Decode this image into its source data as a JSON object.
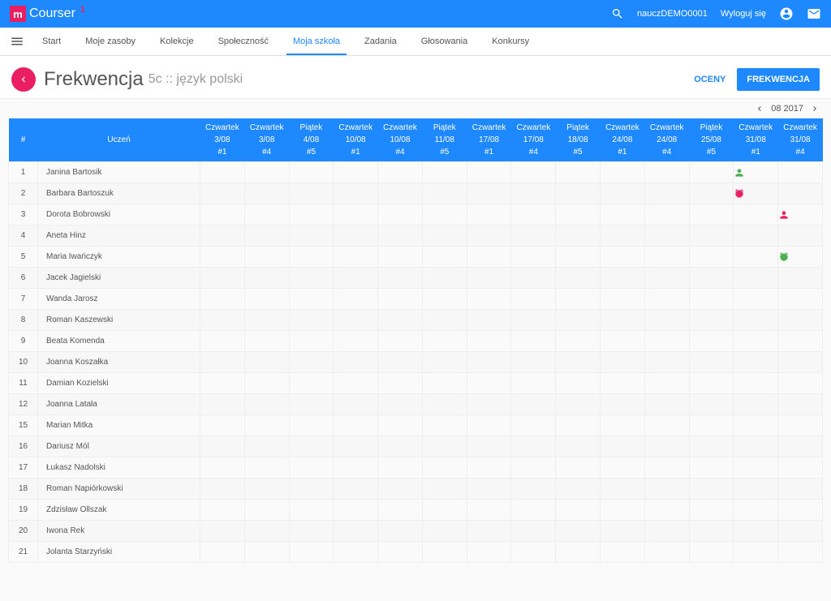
{
  "appbar": {
    "logo_text": "Courser",
    "badge": "1",
    "user": "nauczDEMO0001",
    "logout": "Wyloguj się"
  },
  "nav": {
    "items": [
      "Start",
      "Moje zasoby",
      "Kolekcje",
      "Społeczność",
      "Moja szkoła",
      "Zadania",
      "Głosowania",
      "Konkursy"
    ],
    "active_index": 4
  },
  "title": {
    "main": "Frekwencja",
    "sub": "5c :: język polski",
    "oceny": "OCENY",
    "frekwencja_btn": "FREKWENCJA"
  },
  "month": {
    "label": "08 2017"
  },
  "columns": {
    "idx": "#",
    "name": "Uczeń",
    "days": [
      {
        "dow": "Czwartek",
        "date": "3/08",
        "slot": "#1"
      },
      {
        "dow": "Czwartek",
        "date": "3/08",
        "slot": "#4"
      },
      {
        "dow": "Piątek",
        "date": "4/08",
        "slot": "#5"
      },
      {
        "dow": "Czwartek",
        "date": "10/08",
        "slot": "#1"
      },
      {
        "dow": "Czwartek",
        "date": "10/08",
        "slot": "#4"
      },
      {
        "dow": "Piątek",
        "date": "11/08",
        "slot": "#5"
      },
      {
        "dow": "Czwartek",
        "date": "17/08",
        "slot": "#1"
      },
      {
        "dow": "Czwartek",
        "date": "17/08",
        "slot": "#4"
      },
      {
        "dow": "Piątek",
        "date": "18/08",
        "slot": "#5"
      },
      {
        "dow": "Czwartek",
        "date": "24/08",
        "slot": "#1"
      },
      {
        "dow": "Czwartek",
        "date": "24/08",
        "slot": "#4"
      },
      {
        "dow": "Piątek",
        "date": "25/08",
        "slot": "#5"
      },
      {
        "dow": "Czwartek",
        "date": "31/08",
        "slot": "#1"
      },
      {
        "dow": "Czwartek",
        "date": "31/08",
        "slot": "#4"
      }
    ]
  },
  "students": [
    {
      "n": 1,
      "name": "Janina Bartosik",
      "marks": {
        "12": "person-green"
      }
    },
    {
      "n": 2,
      "name": "Barbara Bartoszuk",
      "marks": {
        "12": "clock-red"
      }
    },
    {
      "n": 3,
      "name": "Dorota Bobrowski",
      "marks": {
        "13": "person-red"
      }
    },
    {
      "n": 4,
      "name": "Aneta Hinz",
      "marks": {}
    },
    {
      "n": 5,
      "name": "Maria Iwańczyk",
      "marks": {
        "13": "clock-green"
      }
    },
    {
      "n": 6,
      "name": "Jacek Jagielski",
      "marks": {}
    },
    {
      "n": 7,
      "name": "Wanda Jarosz",
      "marks": {}
    },
    {
      "n": 8,
      "name": "Roman Kaszewski",
      "marks": {}
    },
    {
      "n": 9,
      "name": "Beata Komenda",
      "marks": {}
    },
    {
      "n": 10,
      "name": "Joanna Koszałka",
      "marks": {}
    },
    {
      "n": 11,
      "name": "Damian Kozielski",
      "marks": {}
    },
    {
      "n": 12,
      "name": "Joanna Latała",
      "marks": {}
    },
    {
      "n": 15,
      "name": "Marian Mitka",
      "marks": {}
    },
    {
      "n": 16,
      "name": "Dariusz Mól",
      "marks": {}
    },
    {
      "n": 17,
      "name": "Łukasz Nadolski",
      "marks": {}
    },
    {
      "n": 18,
      "name": "Roman Napiórkowski",
      "marks": {}
    },
    {
      "n": 19,
      "name": "Zdzisław Ollszak",
      "marks": {}
    },
    {
      "n": 20,
      "name": "Iwona Rek",
      "marks": {}
    },
    {
      "n": 21,
      "name": "Jolanta Starzyński",
      "marks": {}
    }
  ]
}
